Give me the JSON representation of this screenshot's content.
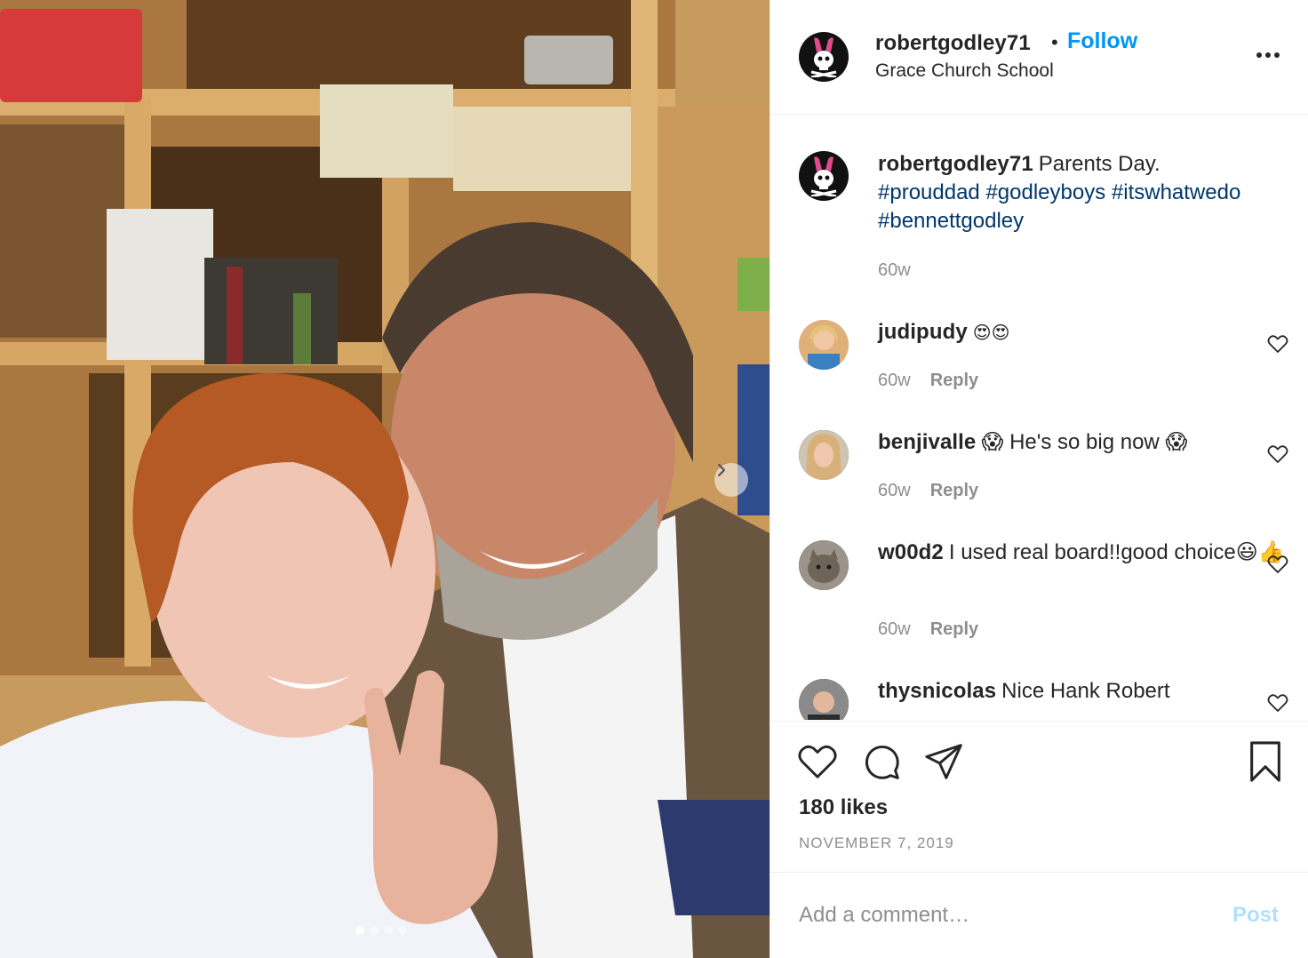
{
  "post": {
    "author": "robertgodley71",
    "follow_label": "Follow",
    "separator": "•",
    "location": "Grace Church School",
    "caption_text": "Parents Day.",
    "hashtags": [
      "#prouddad",
      "#godleyboys",
      "#itswhatwedo",
      "#bennettgodley"
    ],
    "caption_age": "60w",
    "likes": "180 likes",
    "date": "NOVEMBER 7, 2019",
    "carousel": {
      "count": 4,
      "active_index": 0
    }
  },
  "comments": [
    {
      "user": "judipudy",
      "text": "😍😍",
      "age": "60w",
      "reply_label": "Reply"
    },
    {
      "user": "benjivalle",
      "text": "😱 He's so big now 😱",
      "age": "60w",
      "reply_label": "Reply"
    },
    {
      "user": "w00d2",
      "text": "I used real board!!good choice😃👍",
      "age": "60w",
      "reply_label": "Reply"
    },
    {
      "user": "thysnicolas",
      "text": "Nice Hank Robert",
      "age": "",
      "reply_label": ""
    }
  ],
  "add_comment": {
    "placeholder": "Add a comment…",
    "post_label": "Post"
  },
  "colors": {
    "link_blue": "#0095f6",
    "hashtag": "#00376b",
    "muted": "#8e8e8e",
    "post_disabled": "#b2dffc"
  },
  "icons": [
    "more-icon",
    "heart-icon",
    "comment-icon",
    "share-icon",
    "bookmark-icon",
    "chevron-right-icon"
  ]
}
